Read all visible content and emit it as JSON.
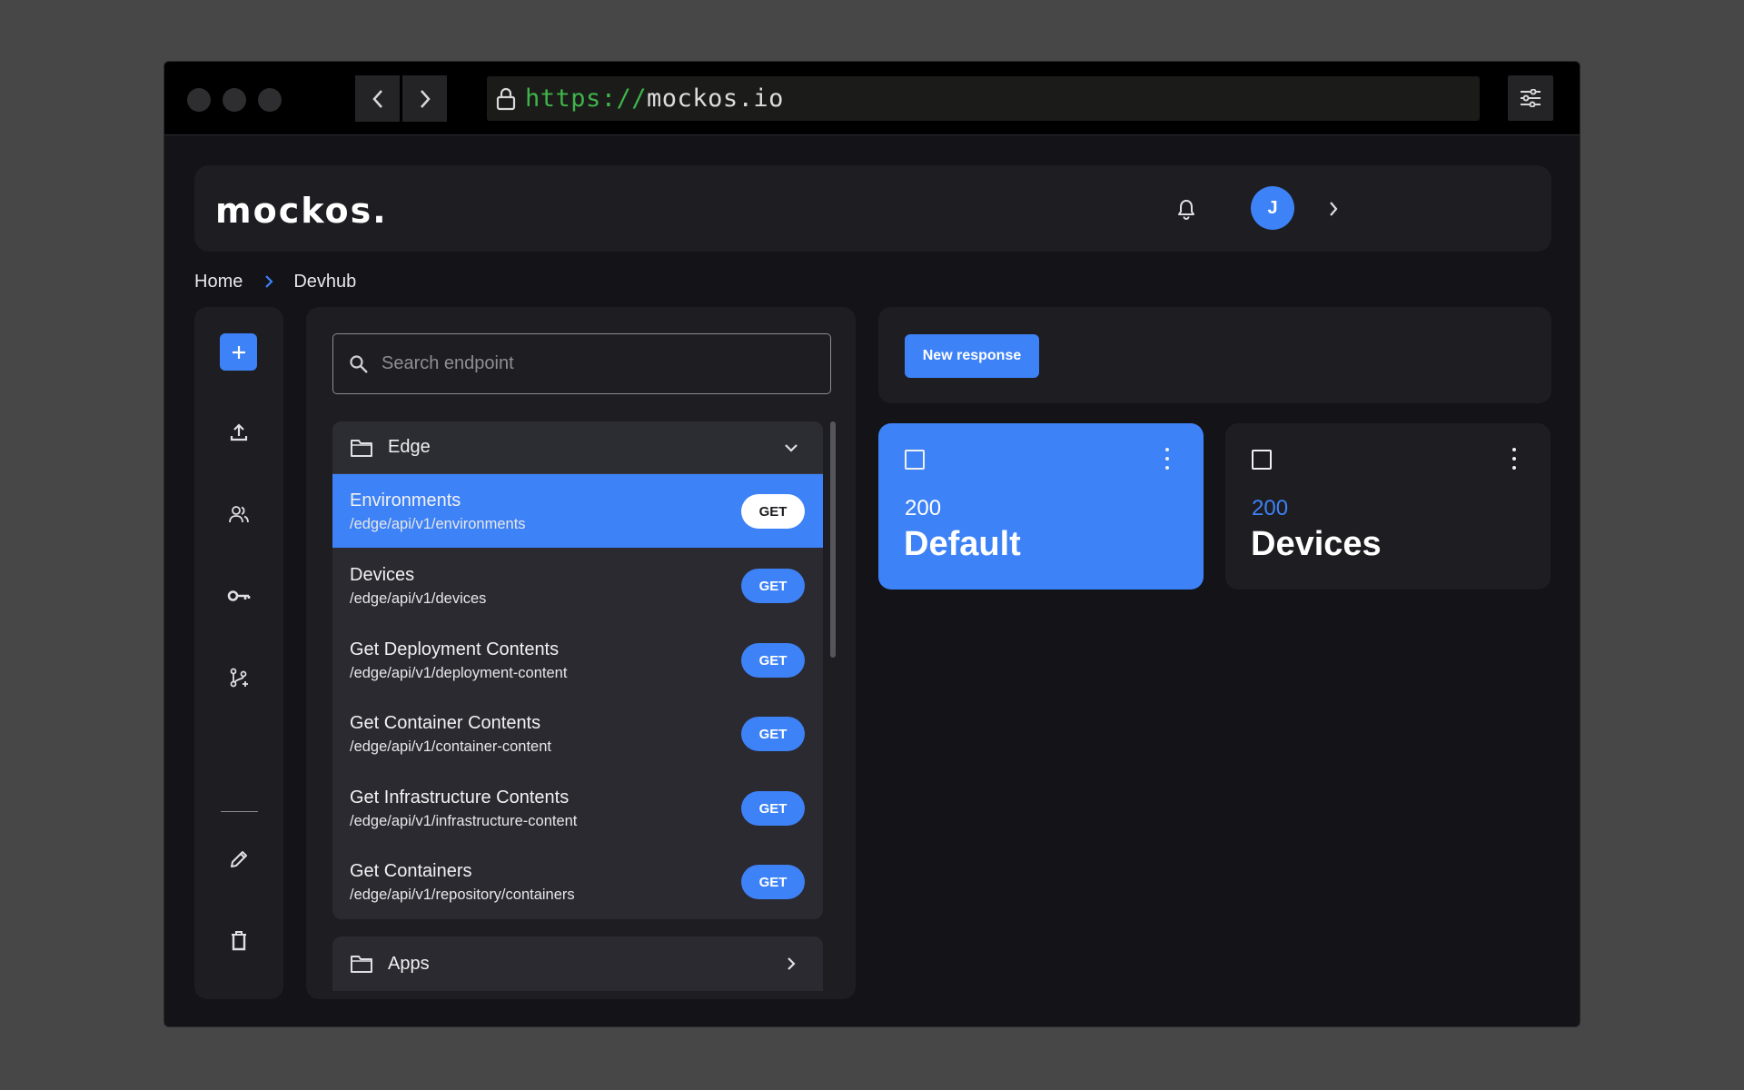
{
  "browser": {
    "url_protocol": "https://",
    "url_host": "mockos.io"
  },
  "header": {
    "logo": "mockos.",
    "avatar_initial": "J"
  },
  "breadcrumb": {
    "home": "Home",
    "current": "Devhub"
  },
  "search": {
    "placeholder": "Search endpoint",
    "value": ""
  },
  "groups": [
    {
      "name": "Edge",
      "expanded": true,
      "endpoints": [
        {
          "name": "Environments",
          "path": "/edge/api/v1/environments",
          "method": "GET",
          "active": true
        },
        {
          "name": "Devices",
          "path": "/edge/api/v1/devices",
          "method": "GET"
        },
        {
          "name": "Get Deployment Contents",
          "path": "/edge/api/v1/deployment-content",
          "method": "GET"
        },
        {
          "name": "Get Container Contents",
          "path": "/edge/api/v1/container-content",
          "method": "GET"
        },
        {
          "name": "Get Infrastructure Contents",
          "path": "/edge/api/v1/infrastructure-content",
          "method": "GET"
        },
        {
          "name": "Get Containers",
          "path": "/edge/api/v1/repository/containers",
          "method": "GET"
        }
      ]
    },
    {
      "name": "Apps",
      "expanded": false
    }
  ],
  "toolbar": {
    "new_response_label": "New response"
  },
  "responses": [
    {
      "code": "200",
      "name": "Default",
      "selected": true
    },
    {
      "code": "200",
      "name": "Devices",
      "selected": false
    }
  ],
  "colors": {
    "accent": "#3d82f6",
    "panel": "#1d1d22",
    "background": "#131318",
    "url_protocol": "#3fb44a"
  }
}
